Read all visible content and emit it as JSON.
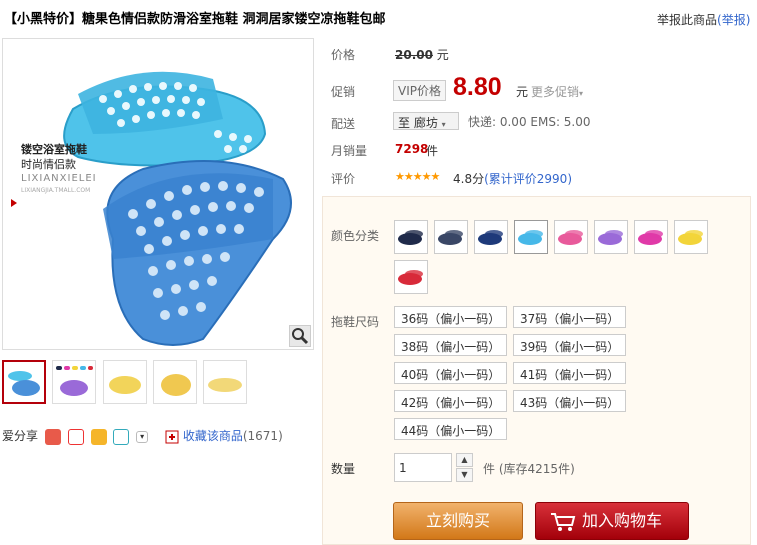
{
  "title": "【小黑特价】糖果色情侣款防滑浴室拖鞋 洞洞居家镂空凉拖鞋包邮",
  "report": {
    "text": "举报此商品",
    "link": "(举报)"
  },
  "image": {
    "caption_line1": "镂空浴室拖鞋",
    "caption_line2": "时尚情侣款",
    "watermark1": "LIXIANXIELEI",
    "watermark2": "LIXIANGJIA.TMALL.COM"
  },
  "price": {
    "label": "价格",
    "original": "20.00",
    "unit": "元"
  },
  "promo": {
    "label": "促销",
    "vip": "VIP价格",
    "price": "8.80",
    "unit": "元",
    "more": "更多促销"
  },
  "delivery": {
    "label": "配送",
    "city": "至 廊坊",
    "info": "快递: 0.00 EMS: 5.00"
  },
  "sales": {
    "label": "月销量",
    "count": "7298",
    "unit": "件"
  },
  "rating": {
    "label": "评价",
    "stars": "★★★★★",
    "score": "4.8分",
    "reviews": "(累计评价2990)"
  },
  "sku": {
    "color_label": "颜色分类",
    "colors": [
      "#1f2a4a",
      "#3a4766",
      "#1e3a7a",
      "#46b8e8",
      "#e85a9b",
      "#9a6ad8",
      "#e03aa8",
      "#f2d43a",
      "#d82a3a"
    ],
    "size_label": "拖鞋尺码",
    "sizes": [
      "36码（偏小一码）",
      "37码（偏小一码）",
      "38码（偏小一码）",
      "39码（偏小一码）",
      "40码（偏小一码）",
      "41码（偏小一码）",
      "42码（偏小一码）",
      "43码（偏小一码）",
      "44码（偏小一码）"
    ],
    "qty_label": "数量",
    "qty_value": "1",
    "qty_unit": "件",
    "stock": "(库存4215件)"
  },
  "buttons": {
    "buy": "立刻购买",
    "cart": "加入购物车"
  },
  "share": {
    "label": "爱分享"
  },
  "favorite": {
    "label": "收藏该商品",
    "count": "(1671)"
  }
}
